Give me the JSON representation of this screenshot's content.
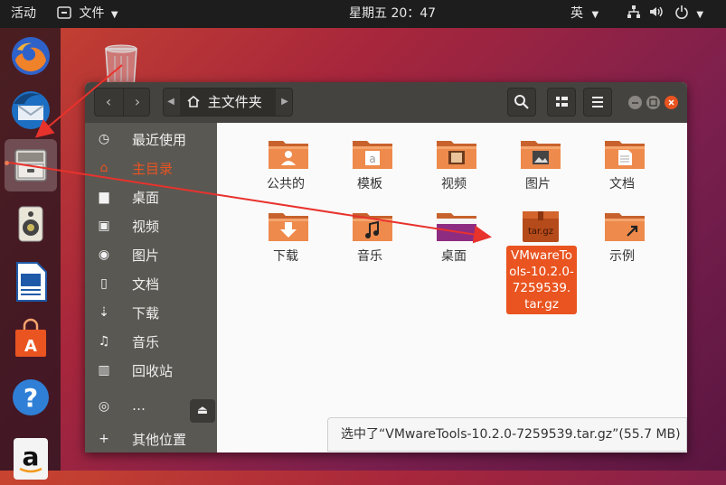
{
  "topbar": {
    "activities": "活动",
    "app_menu": "文件",
    "clock": "星期五 20：47",
    "input_method": "英"
  },
  "dock": {
    "items": [
      "firefox",
      "thunderbird",
      "files",
      "rhythmbox",
      "libreoffice-writer",
      "software-center",
      "help",
      "amazon"
    ]
  },
  "window": {
    "path_label": "主文件夹"
  },
  "sidebar": {
    "items": [
      {
        "label": "最近使用",
        "icon": "clock-icon"
      },
      {
        "label": "主目录",
        "icon": "home-icon"
      },
      {
        "label": "桌面",
        "icon": "folder-icon"
      },
      {
        "label": "视频",
        "icon": "video-icon"
      },
      {
        "label": "图片",
        "icon": "camera-icon"
      },
      {
        "label": "文档",
        "icon": "document-icon"
      },
      {
        "label": "下载",
        "icon": "download-icon"
      },
      {
        "label": "音乐",
        "icon": "music-icon"
      },
      {
        "label": "回收站",
        "icon": "trash-icon"
      },
      {
        "label": "…",
        "icon": "disc-icon"
      },
      {
        "label": "其他位置",
        "icon": "plus-icon"
      }
    ]
  },
  "files": [
    {
      "name": "公共的",
      "icon": "folder-public"
    },
    {
      "name": "模板",
      "icon": "folder-templates"
    },
    {
      "name": "视频",
      "icon": "folder-videos"
    },
    {
      "name": "图片",
      "icon": "folder-pictures"
    },
    {
      "name": "文档",
      "icon": "folder-documents"
    },
    {
      "name": "下载",
      "icon": "folder-download"
    },
    {
      "name": "音乐",
      "icon": "folder-music"
    },
    {
      "name": "桌面",
      "icon": "folder-desktop"
    },
    {
      "name": "VMwareTools-10.2.0-7259539.tar.gz",
      "name_lines": [
        "VMwareTo",
        "ols-10.2.0-",
        "7259539.",
        "tar.gz"
      ],
      "icon_label": "tar.gz",
      "icon": "archive",
      "selected": true
    },
    {
      "name": "示例",
      "icon": "folder-link"
    }
  ],
  "status": {
    "text": "选中了“VMwareTools-10.2.0-7259539.tar.gz”(55.7 MB)"
  },
  "colors": {
    "accent": "#e95420",
    "topbar": "#1d1d1d",
    "header": "#45433f",
    "sidebar": "#5a5853",
    "arrow": "#e8322c"
  }
}
